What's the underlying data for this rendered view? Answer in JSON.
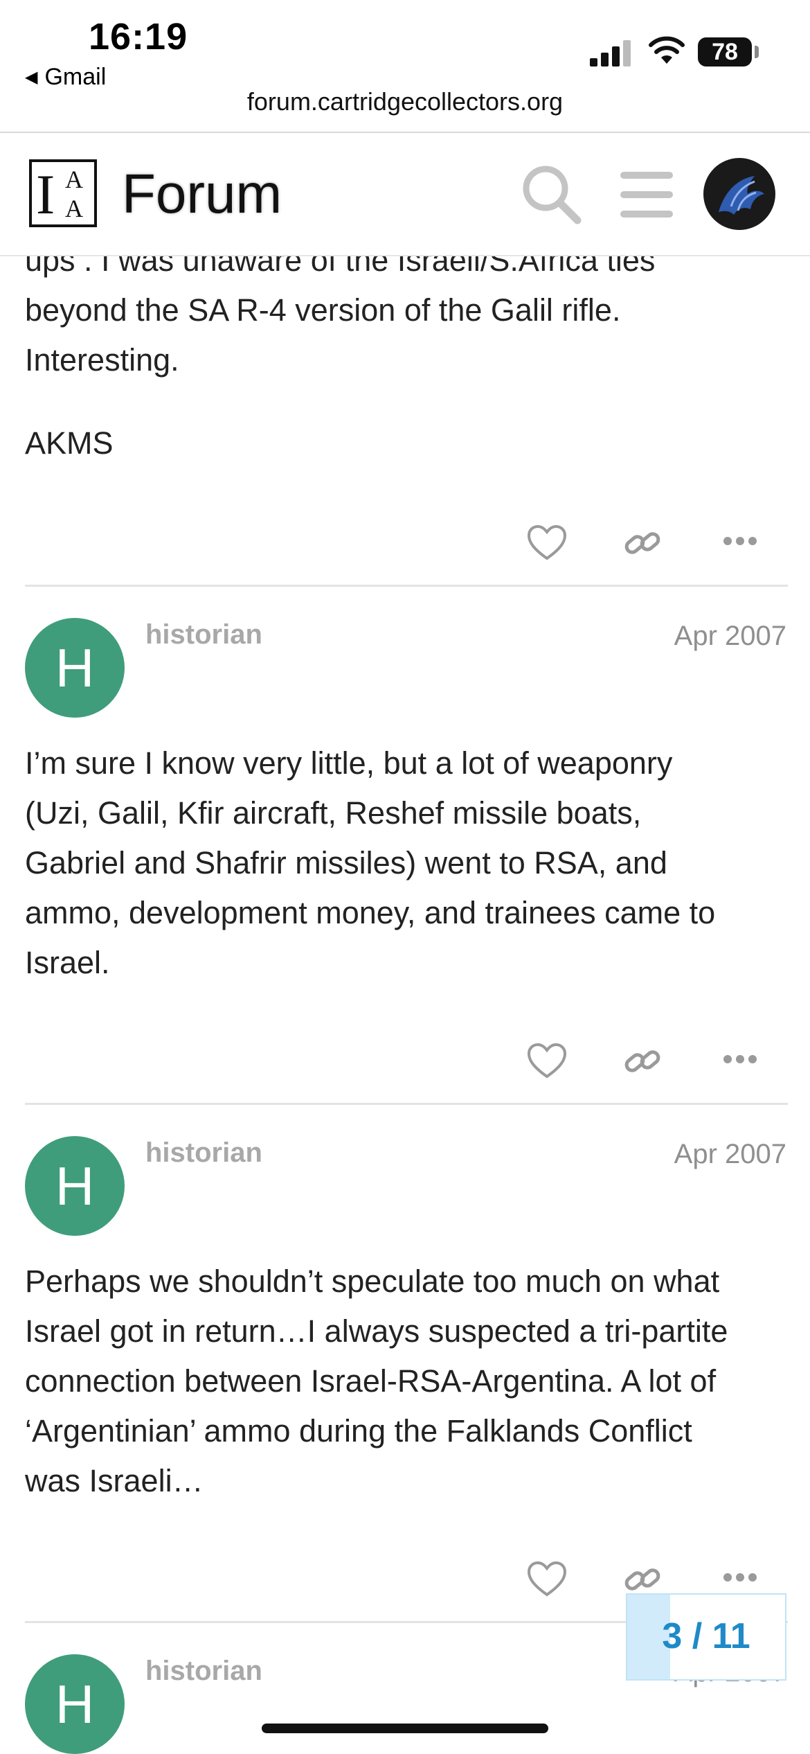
{
  "status_bar": {
    "time": "16:19",
    "back_app": "Gmail",
    "battery": "78",
    "url": "forum.cartridgecollectors.org"
  },
  "header": {
    "logo_letters": [
      "I",
      "A",
      "A"
    ],
    "title": "Forum"
  },
  "posts": [
    {
      "text": [
        "ups . I was unaware of the Israeli/S.Africa ties",
        "beyond the SA R-4 version of the Galil rifle.",
        "Interesting.",
        "",
        "AKMS"
      ]
    },
    {
      "avatar_letter": "H",
      "username": "historian",
      "date": "Apr 2007",
      "text": [
        "I’m sure I know very little, but a lot of weaponry",
        "(Uzi, Galil, Kfir aircraft, Reshef missile boats,",
        "Gabriel and Shafrir missiles) went to RSA, and",
        "ammo, development money, and trainees came to",
        "Israel."
      ]
    },
    {
      "avatar_letter": "H",
      "username": "historian",
      "date": "Apr 2007",
      "text": [
        "Perhaps we shouldn’t speculate too much on what",
        "Israel got in return…I always suspected a tri-partite",
        "connection between Israel-RSA-Argentina. A lot of",
        "‘Argentinian’ ammo during the Falklands Conflict",
        "was Israeli…"
      ]
    },
    {
      "avatar_letter": "H",
      "username": "historian",
      "date": "Apr 2007"
    }
  ],
  "topic_progress": {
    "current": 3,
    "total": 11,
    "label": "3 / 11"
  },
  "colors": {
    "avatar_bg": "#3f9d7b",
    "progress_text": "#1e8ac8",
    "muted": "#a8a8a8"
  }
}
